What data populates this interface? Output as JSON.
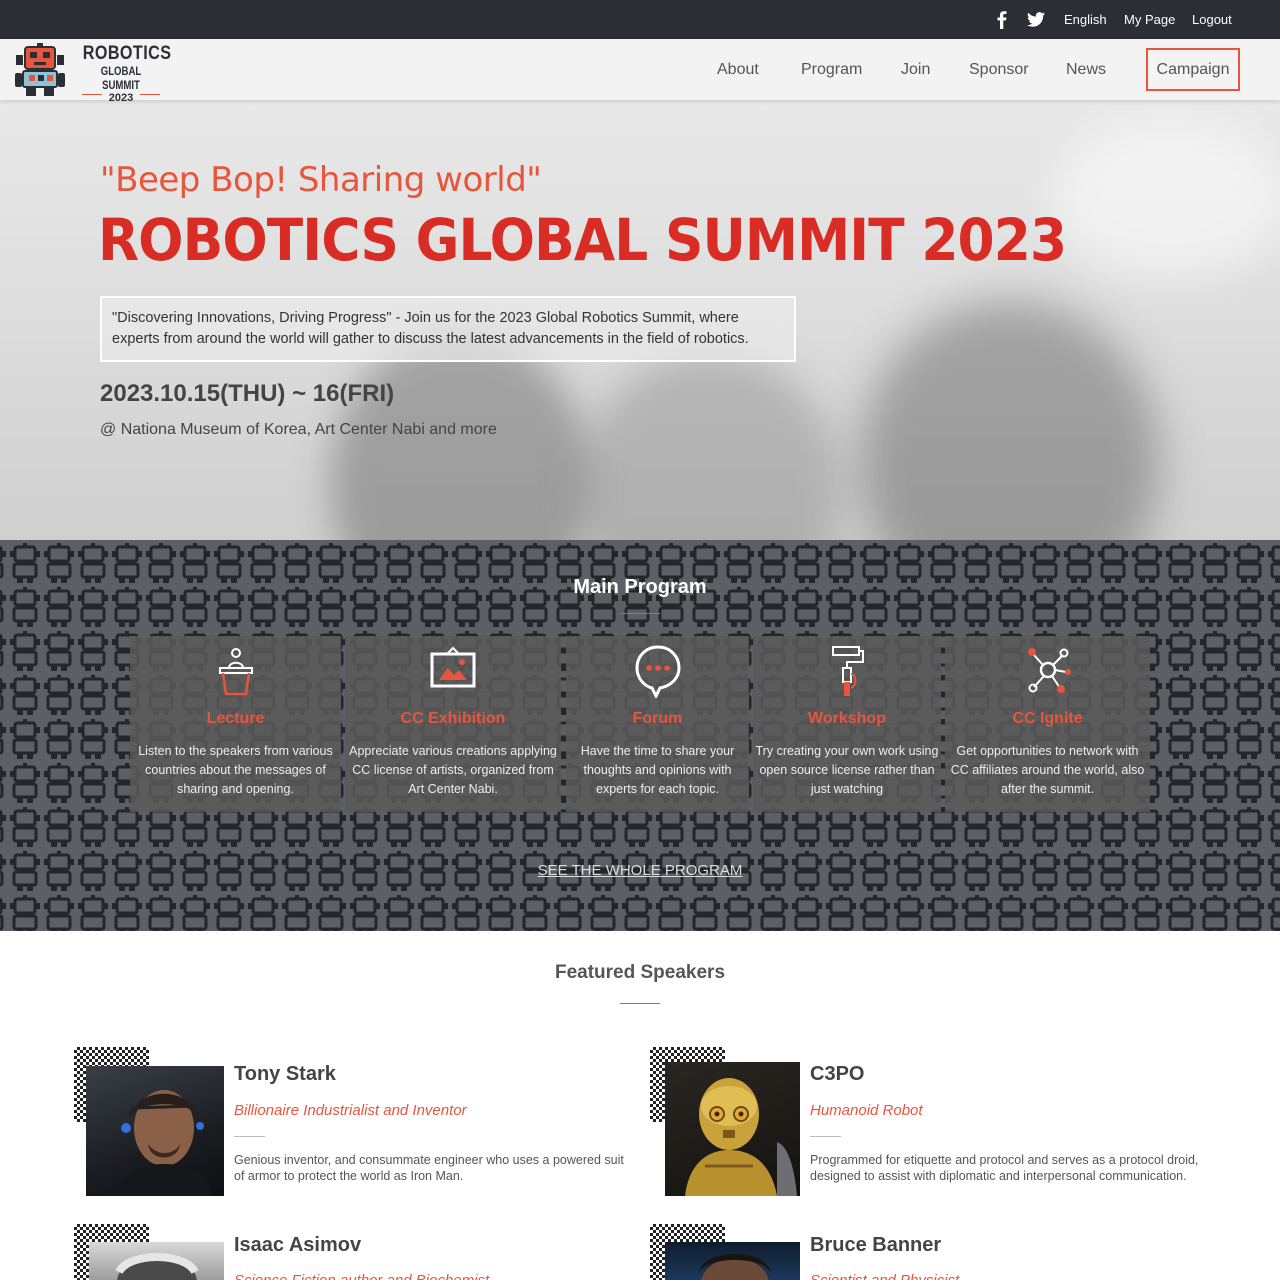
{
  "topbar": {
    "facebook_icon": "facebook-icon",
    "twitter_icon": "twitter-icon",
    "language": "English",
    "mypage": "My Page",
    "logout": "Logout"
  },
  "logo": {
    "line1": "ROBOTICS",
    "line2": "GLOBAL SUMMIT",
    "line3": "2023"
  },
  "nav": {
    "items": [
      "About",
      "Program",
      "Join",
      "Sponsor",
      "News"
    ],
    "campaign": "Campaign"
  },
  "hero": {
    "tagline": "\"Beep Bop! Sharing world\"",
    "title": "ROBOTICS GLOBAL SUMMIT 2023",
    "description": "\"Discovering Innovations, Driving Progress\" - Join us for the 2023 Global Robotics Summit, where experts from around the world will gather to discuss the latest advancements in the field of robotics.",
    "date": "2023.10.15(THU) ~ 16(FRI)",
    "venue": "@ Nationa Museum of Korea, Art Center Nabi and more"
  },
  "program": {
    "title": "Main Program",
    "cards": [
      {
        "icon": "podium-speaker-icon",
        "title": "Lecture",
        "desc": "Listen to the speakers from various countries about the messages of sharing and opening."
      },
      {
        "icon": "picture-frame-icon",
        "title": "CC Exhibition",
        "desc": "Appreciate various creations applying CC license of artists, organized from Art Center Nabi."
      },
      {
        "icon": "speech-bubble-icon",
        "title": "Forum",
        "desc": "Have the time to share your thoughts and opinions with experts for each topic."
      },
      {
        "icon": "paint-roller-icon",
        "title": "Workshop",
        "desc": "Try creating your own work using open source license rather than just watching"
      },
      {
        "icon": "network-nodes-icon",
        "title": "CC Ignite",
        "desc": "Get opportunities to network with CC affiliates around the world, also after the summit."
      }
    ],
    "see_all": "SEE THE WHOLE PROGRAM"
  },
  "speakers": {
    "title": "Featured Speakers",
    "list": [
      {
        "name": "Tony Stark",
        "role": "Billionaire Industrialist and Inventor",
        "bio": "Genious inventor, and consummate engineer who uses a powered suit of armor to protect the world as Iron Man."
      },
      {
        "name": "C3PO",
        "role": "Humanoid Robot",
        "bio": "Programmed for etiquette and protocol and serves as a protocol droid, designed to assist with diplomatic and interpersonal communication."
      },
      {
        "name": "Isaac Asimov",
        "role": "Science Fiction author and Biochemist",
        "bio": ""
      },
      {
        "name": "Bruce Banner",
        "role": "Scientist and Physicist",
        "bio": ""
      }
    ]
  },
  "colors": {
    "accent": "#e8553d",
    "title_red": "#d92c25",
    "dark": "#2b2e35"
  }
}
